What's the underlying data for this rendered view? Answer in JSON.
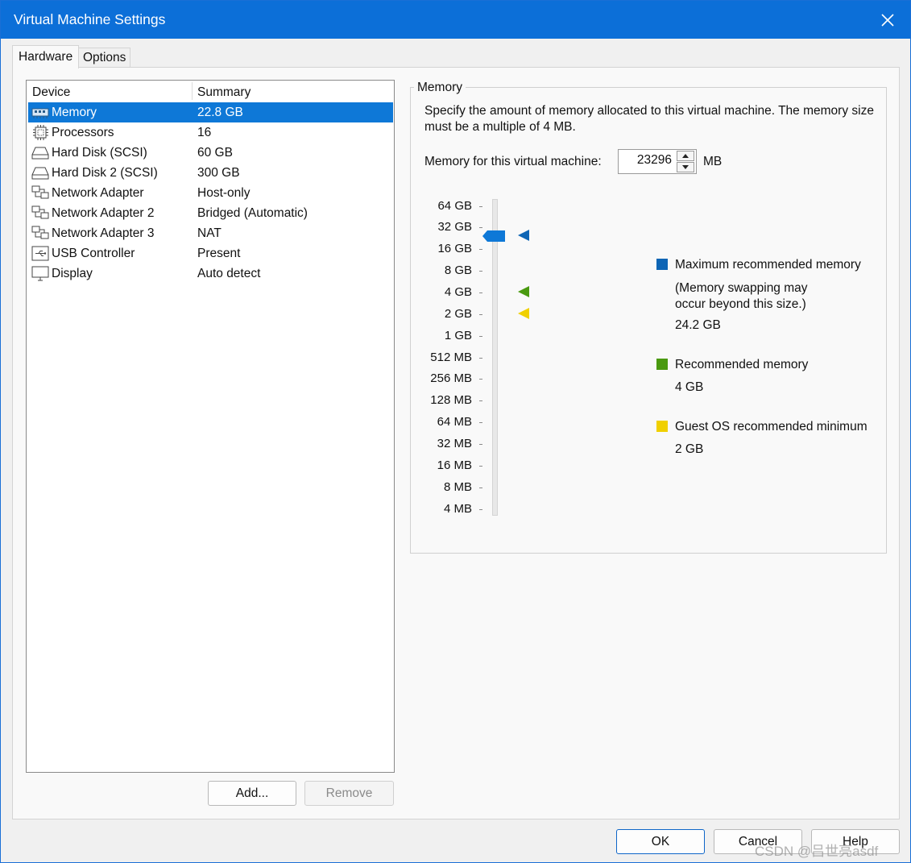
{
  "window": {
    "title": "Virtual Machine Settings"
  },
  "tabs": [
    {
      "label": "Hardware",
      "active": true
    },
    {
      "label": "Options",
      "active": false
    }
  ],
  "device_list": {
    "columns": [
      "Device",
      "Summary"
    ],
    "rows": [
      {
        "name": "Memory",
        "summary": "22.8 GB",
        "icon": "memory-icon",
        "selected": true
      },
      {
        "name": "Processors",
        "summary": "16",
        "icon": "processor-icon"
      },
      {
        "name": "Hard Disk (SCSI)",
        "summary": "60 GB",
        "icon": "hard-disk-icon"
      },
      {
        "name": "Hard Disk 2 (SCSI)",
        "summary": "300 GB",
        "icon": "hard-disk-icon"
      },
      {
        "name": "Network Adapter",
        "summary": "Host-only",
        "icon": "network-adapter-icon"
      },
      {
        "name": "Network Adapter 2",
        "summary": "Bridged (Automatic)",
        "icon": "network-adapter-icon"
      },
      {
        "name": "Network Adapter 3",
        "summary": "NAT",
        "icon": "network-adapter-icon"
      },
      {
        "name": "USB Controller",
        "summary": "Present",
        "icon": "usb-icon"
      },
      {
        "name": "Display",
        "summary": "Auto detect",
        "icon": "display-icon"
      }
    ]
  },
  "buttons": {
    "add": "Add...",
    "remove": "Remove",
    "ok": "OK",
    "cancel": "Cancel",
    "help": "Help"
  },
  "memory_panel": {
    "group_title": "Memory",
    "description": "Specify the amount of memory allocated to this virtual machine. The memory size must be a multiple of 4 MB.",
    "field_label": "Memory for this virtual machine:",
    "value": "23296",
    "unit": "MB",
    "scale_labels": [
      "64 GB",
      "32 GB",
      "16 GB",
      "8 GB",
      "4 GB",
      "2 GB",
      "1 GB",
      "512 MB",
      "256 MB",
      "128 MB",
      "64 MB",
      "32 MB",
      "16 MB",
      "8 MB",
      "4 MB"
    ],
    "legend": {
      "max": {
        "label": "Maximum recommended memory",
        "note": "(Memory swapping may occur beyond this size.)",
        "value": "24.2 GB",
        "color": "#0e65b5"
      },
      "recommended": {
        "label": "Recommended memory",
        "value": "4 GB",
        "color": "#4a9a10"
      },
      "minimum": {
        "label": "Guest OS recommended minimum",
        "value": "2 GB",
        "color": "#f0d000"
      }
    },
    "thumb_color": "#0e78d7"
  },
  "watermark": "CSDN @吕世亮asdf"
}
